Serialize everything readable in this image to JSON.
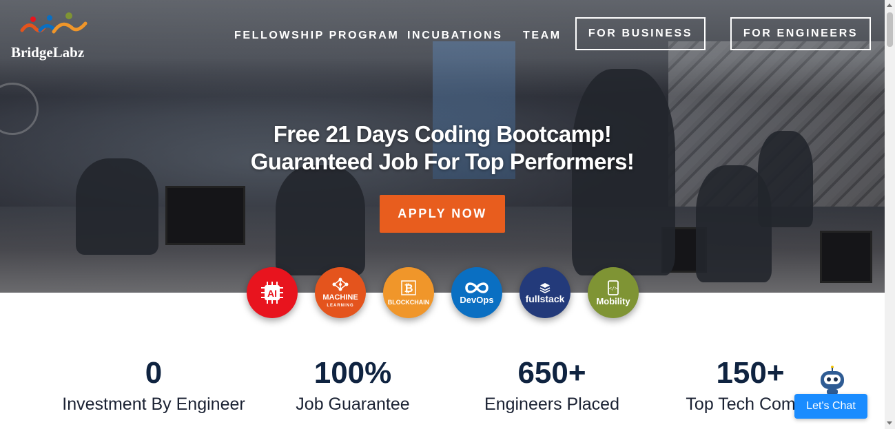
{
  "brand": {
    "name": "BridgeLabz"
  },
  "nav": {
    "fellowship": "FELLOWSHIP PROGRAM",
    "incubations": "INCUBATIONS",
    "team": "TEAM",
    "for_business": "FOR BUSINESS",
    "for_engineers": "FOR ENGINEERS"
  },
  "hero": {
    "headline_line1": "Free 21 Days Coding Bootcamp!",
    "headline_line2": "Guaranteed Job For Top Performers!",
    "cta": "APPLY NOW",
    "cta_color": "#e85d1e"
  },
  "tech": [
    {
      "label": "AI",
      "icon": "ai-chip-icon",
      "color": "#e8141e"
    },
    {
      "label": "MACHINE",
      "sub": "LEARNING",
      "icon": "machine-learning-icon",
      "color": "#e4541d"
    },
    {
      "label": "BLOCKCHAIN",
      "icon": "bitcoin-icon",
      "color": "#f0962a"
    },
    {
      "label": "DevOps",
      "icon": "infinity-icon",
      "color": "#0a6fc2"
    },
    {
      "label": "fullstack",
      "icon": "layers-icon",
      "color": "#233a7a"
    },
    {
      "label": "Mobility",
      "icon": "mobile-code-icon",
      "color": "#7f9434"
    }
  ],
  "stats": [
    {
      "value": "0",
      "label": "Investment By Engineer"
    },
    {
      "value": "100%",
      "label": "Job Guarantee"
    },
    {
      "value": "650+",
      "label": "Engineers Placed"
    },
    {
      "value": "150+",
      "label": "Top Tech Compa"
    }
  ],
  "chat": {
    "label": "Let's Chat",
    "color": "#1a8cff"
  }
}
